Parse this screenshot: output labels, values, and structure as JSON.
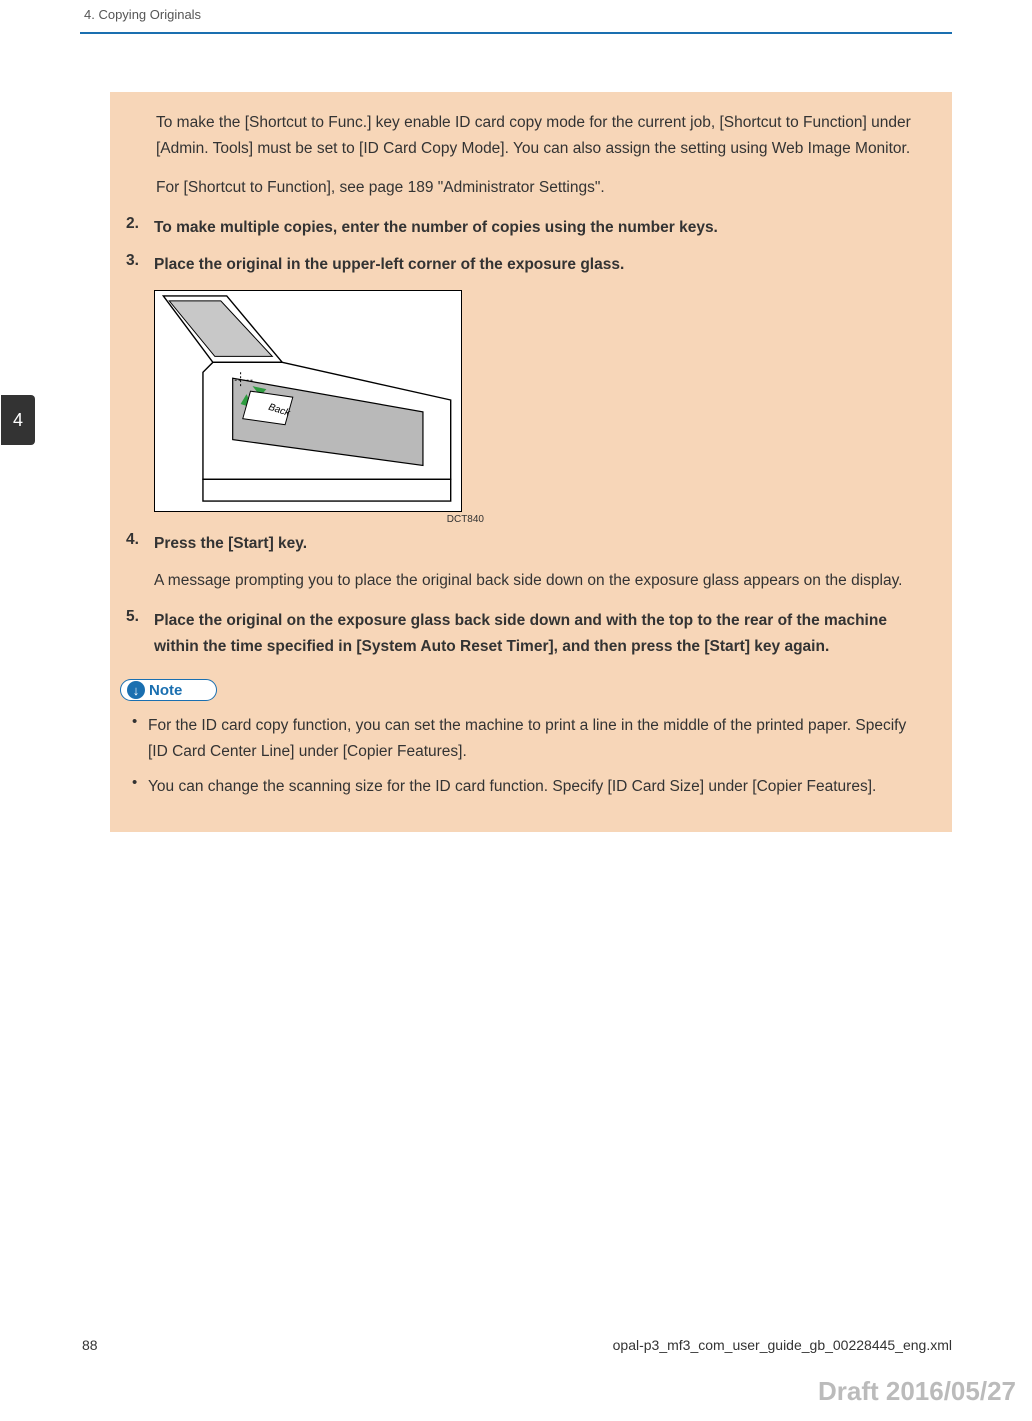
{
  "header": {
    "chapter_title": "4. Copying Originals",
    "tab_number": "4"
  },
  "content": {
    "intro_p1": "To make the [Shortcut to Func.] key enable ID card copy mode for the current job, [Shortcut to Function] under [Admin. Tools] must be set to [ID Card Copy Mode]. You can also assign the setting using Web Image Monitor.",
    "intro_p2": "For [Shortcut to Function], see page 189 \"Administrator Settings\".",
    "steps": [
      {
        "num": "2.",
        "text": "To make multiple copies, enter the number of copies using the number keys.",
        "bold": true
      },
      {
        "num": "3.",
        "text": "Place the original in the upper-left corner of the exposure glass.",
        "bold": true
      }
    ],
    "figure_caption": "DCT840",
    "figure_card_label": "Back",
    "step4": {
      "num": "4.",
      "text": "Press the [Start] key."
    },
    "step4_body": "A message prompting you to place the original back side down on the exposure glass appears on the display.",
    "step5": {
      "num": "5.",
      "text": "Place the original on the exposure glass back side down and with the top to the rear of the machine within the time specified in [System Auto Reset Timer], and then press the [Start] key again."
    },
    "note_label": "Note",
    "bullets": [
      "For the ID card copy function, you can set the machine to print a line in the middle of the printed paper. Specify [ID Card Center Line] under [Copier Features].",
      "You can change the scanning size for the ID card function. Specify [ID Card Size] under [Copier Features]."
    ]
  },
  "footer": {
    "page_number": "88",
    "source_file": "opal-p3_mf3_com_user_guide_gb_00228445_eng.xml",
    "draft": "Draft 2016/05/27"
  }
}
